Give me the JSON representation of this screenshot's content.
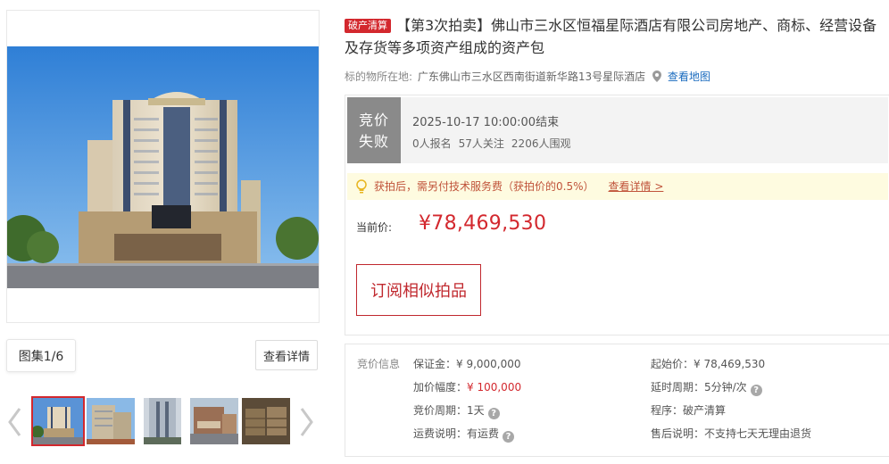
{
  "gallery": {
    "album_label": "图集1/6",
    "detail_button": "查看详情",
    "thumbnails": [
      "hotel-exterior",
      "building-side",
      "building-facade",
      "street-view",
      "storage-room"
    ],
    "active_thumbnail_index": 0
  },
  "item": {
    "tag": "破产清算",
    "title": "【第3次拍卖】佛山市三水区恒福星际酒店有限公司房地产、商标、经营设备及存货等多项资产组成的资产包",
    "location_label": "标的物所在地:",
    "location_value": "广东佛山市三水区西南街道新华路13号星际酒店",
    "map_link": "查看地图"
  },
  "auction": {
    "status": "竞价失败",
    "status_line1": "竞价",
    "status_line2": "失败",
    "end_time": "2025-10-17 10:00:00结束",
    "stats": {
      "signups": "0人报名",
      "follows": "57人关注",
      "views": "2206人围观"
    },
    "fee_notice": "获拍后，需另付技术服务费（获拍价的0.5%）",
    "fee_link": "查看详情 >",
    "price_label": "当前价:",
    "price_value": "¥78,469,530",
    "subscribe_button": "订阅相似拍品"
  },
  "bidding_info": {
    "title": "竞价信息",
    "deposit": "保证金：¥ 9,000,000",
    "increment_label": "加价幅度：",
    "increment_value": "¥ 100,000",
    "bid_period": "竞价周期：1天",
    "shipping": "运费说明：有运费",
    "start_price": "起始价：¥ 78,469,530",
    "delay_period": "延时周期：5分钟/次",
    "procedure": "程序：破产清算",
    "after_sale": "售后说明：不支持七天无理由退货"
  },
  "colors": {
    "accent_red": "#d3282e",
    "status_gray": "#8a8a8a",
    "link_blue": "#1a6bbf",
    "notice_bg": "#fefbe0"
  }
}
